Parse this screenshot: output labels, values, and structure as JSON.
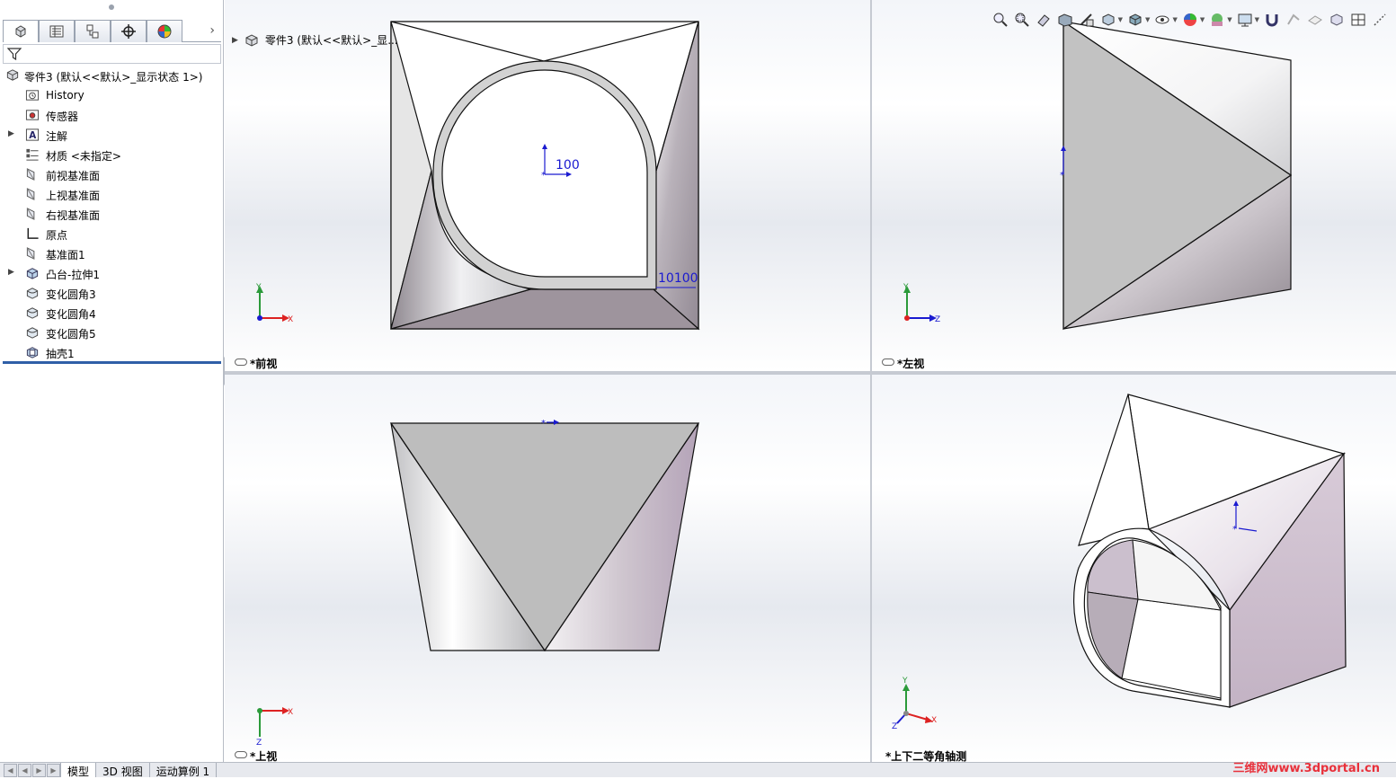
{
  "panel": {
    "tree": [
      {
        "label": "零件3  (默认<<默认>_显示状态 1>)",
        "icon": "part-icon",
        "expandable": false,
        "root": true
      },
      {
        "label": "History",
        "icon": "history-folder-icon",
        "expandable": false
      },
      {
        "label": "传感器",
        "icon": "sensor-icon",
        "expandable": false
      },
      {
        "label": "注解",
        "icon": "annotation-icon",
        "expandable": true
      },
      {
        "label": "材质 <未指定>",
        "icon": "material-icon",
        "expandable": false
      },
      {
        "label": "前视基准面",
        "icon": "plane-icon",
        "expandable": false
      },
      {
        "label": "上视基准面",
        "icon": "plane-icon",
        "expandable": false
      },
      {
        "label": "右视基准面",
        "icon": "plane-icon",
        "expandable": false
      },
      {
        "label": "原点",
        "icon": "origin-icon",
        "expandable": false
      },
      {
        "label": "基准面1",
        "icon": "plane-icon",
        "expandable": false
      },
      {
        "label": "凸台-拉伸1",
        "icon": "extrude-icon",
        "expandable": true
      },
      {
        "label": "变化圆角3",
        "icon": "fillet-icon",
        "expandable": false
      },
      {
        "label": "变化圆角4",
        "icon": "fillet-icon",
        "expandable": false
      },
      {
        "label": "变化圆角5",
        "icon": "fillet-icon",
        "expandable": false
      },
      {
        "label": "抽壳1",
        "icon": "shell-icon",
        "expandable": false
      }
    ]
  },
  "bottom_tabs": [
    "模型",
    "3D 视图",
    "运动算例 1"
  ],
  "viewports": {
    "front": {
      "label": "*前视",
      "breadcrumb": "零件3  (默认<<默认>_显...",
      "dim_center": "100",
      "dim_corner": "10100"
    },
    "left": {
      "label": "*左视"
    },
    "top": {
      "label": "*上视"
    },
    "iso": {
      "label": "*上下二等角轴测"
    }
  },
  "triad": {
    "x": "X",
    "y": "Y",
    "z": "Z"
  },
  "watermark": "三维网www.3dportal.cn",
  "colors": {
    "accent_blue": "#2f5fa7",
    "dimension_blue": "#1a1ad0",
    "face_mauve": "#9e949d",
    "watermark_red": "#e8303a"
  }
}
